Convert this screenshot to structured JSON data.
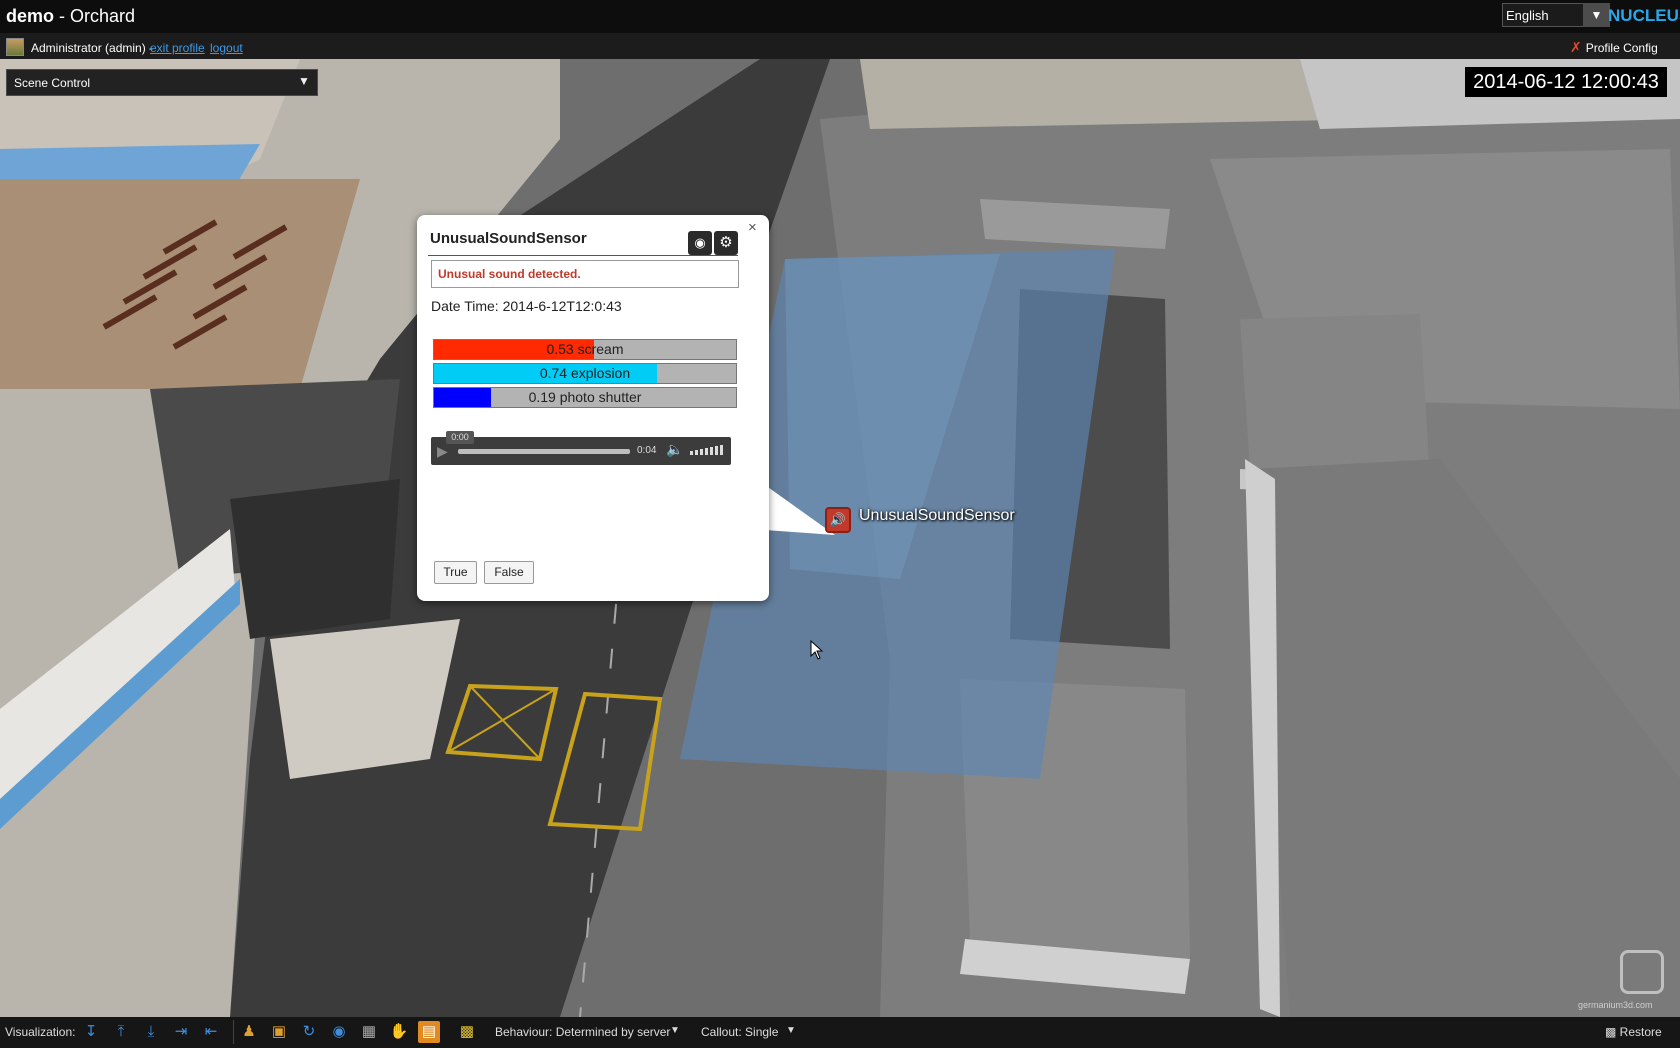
{
  "window": {
    "app_name": "demo",
    "project": "Orchard"
  },
  "header": {
    "language": "English",
    "brand_part1": "NU",
    "brand_part2": "CLEUS"
  },
  "profile": {
    "user": "Administrator (admin) -",
    "exit_profile": "exit profile",
    "logout": "logout",
    "config": "Profile Config"
  },
  "scene_control": {
    "label": "Scene Control"
  },
  "clock": "2014-06-12 12:00:43",
  "popup": {
    "title": "UnusualSoundSensor",
    "alert": "Unusual sound detected.",
    "datetime": "Date Time: 2014-6-12T12:0:43",
    "classes": [
      {
        "label": "0.53 scream",
        "value": 0.53,
        "color": "#ff2a00"
      },
      {
        "label": "0.74 explosion",
        "value": 0.74,
        "color": "#00ccf5"
      },
      {
        "label": "0.19 photo shutter",
        "value": 0.19,
        "color": "#0000ff"
      }
    ],
    "audio": {
      "current": "0:00",
      "duration": "0:04"
    },
    "true_label": "True",
    "false_label": "False"
  },
  "sensor": {
    "label": "UnusualSoundSensor",
    "color": "#c0392b"
  },
  "watermark": "germanium3d.com",
  "toolbar": {
    "visualization_label": "Visualization:",
    "behaviour": "Behaviour: Determined by server",
    "callout": "Callout: Single",
    "restore": "Restore"
  }
}
